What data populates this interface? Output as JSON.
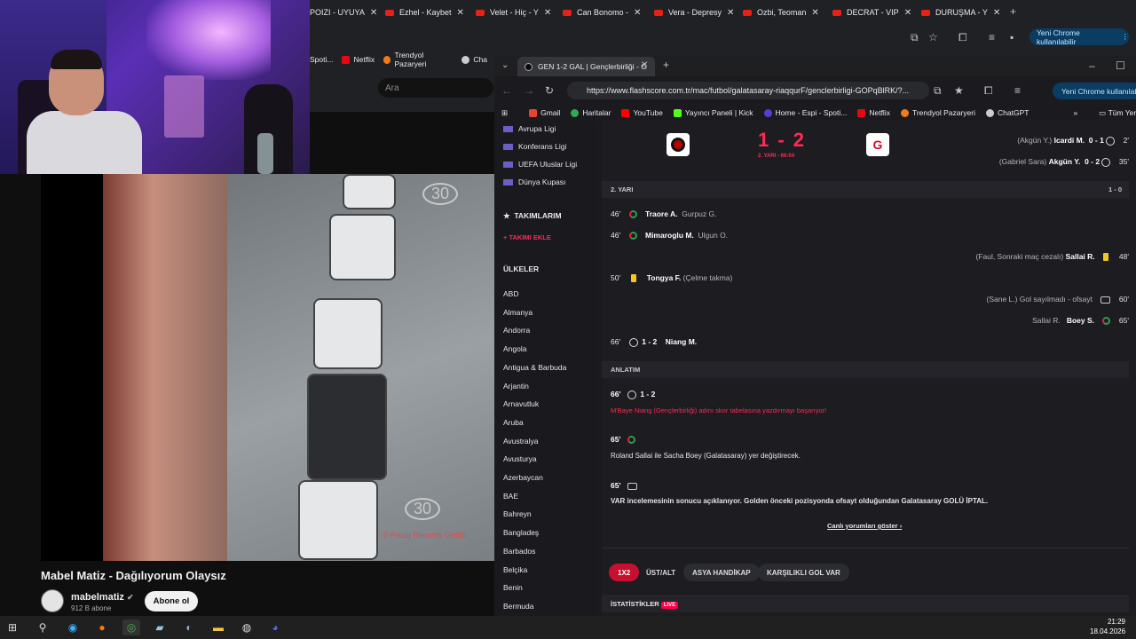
{
  "browser_top": {
    "tabs": [
      {
        "label": "POIZI - UYUYA"
      },
      {
        "label": "Ezhel - Kaybet"
      },
      {
        "label": "Velet - Hiç - Y"
      },
      {
        "label": "Can Bonomo -"
      },
      {
        "label": "Vera - Depresy"
      },
      {
        "label": "Ozbi, Teoman"
      },
      {
        "label": "DECRAT - VIP"
      },
      {
        "label": "DURUŞMA - Y"
      }
    ],
    "yeni_chrome": "Yeni Chrome kullanılabilir",
    "bookmarks": [
      "Spoti...",
      "Netflix",
      "Trendyol Pazaryeri",
      "Cha"
    ],
    "search_placeholder": "Ara"
  },
  "video": {
    "title": "Mabel Matiz - Dağılıyorum Olaysız",
    "channel": "mabelmatiz",
    "subscribers": "912 B abone",
    "subscribe_label": "Abone ol",
    "watermark": "© Pasaj Records Gmbh"
  },
  "browser2": {
    "tab_title": "GEN 1-2 GAL | Gençlerbirliği - G",
    "url": "https://www.flashscore.com.tr/mac/futbol/galatasaray-riaqqurF/genclerbirligi-GOPqBlRK/?...",
    "yeni_chrome": "Yeni Chrome kullanılabilir",
    "bookmarks": [
      "Gmail",
      "Haritalar",
      "YouTube",
      "Yayıncı Paneli | Kick",
      "Home - Espi - Spoti...",
      "Netflix",
      "Trendyol Pazaryeri",
      "ChatGPT"
    ],
    "all_bookmarks": "Tüm Yer İşa"
  },
  "sidebar": {
    "competitions": [
      "Avrupa Ligi",
      "Konferans Ligi",
      "UEFA Uluslar Ligi",
      "Dünya Kupası"
    ],
    "my_teams": "TAKIMLARIM",
    "add_team": "+ TAKIMI EKLE",
    "countries_title": "ÜLKELER",
    "countries": [
      "ABD",
      "Almanya",
      "Andorra",
      "Angola",
      "Antigua & Barbuda",
      "Arjantin",
      "Arnavutluk",
      "Aruba",
      "Avustralya",
      "Avusturya",
      "Azerbaycan",
      "BAE",
      "Bahreyn",
      "Bangladeş",
      "Barbados",
      "Belçika",
      "Benin",
      "Bermuda"
    ]
  },
  "match": {
    "score": "1 - 2",
    "status": "2. YARI - 66:04",
    "first_half_events": [
      {
        "assist": "(Akgün Y.)",
        "player": "Icardi M.",
        "score": "0 - 1",
        "minute": "2'"
      },
      {
        "assist": "(Gabriel Sara)",
        "player": "Akgün Y.",
        "score": "0 - 2",
        "minute": "35'"
      }
    ],
    "second_half_label": "2. YARI",
    "second_half_score": "1 - 0",
    "events": [
      {
        "minute": "46'",
        "player": "Traore A.",
        "detail": "Gurpuz G."
      },
      {
        "minute": "46'",
        "player": "Mimaroglu M.",
        "detail": "Ulgun O."
      },
      {
        "minute": "48'",
        "player": "Sallai R.",
        "detail": "(Faul, Sonraki maç cezalı)"
      },
      {
        "minute": "50'",
        "player": "Tongya F.",
        "detail": "(Çelme takma)"
      },
      {
        "minute": "60'",
        "player": "(Sane L.) Gol sayılmadı - ofsayt",
        "detail": ""
      },
      {
        "minute": "65'",
        "player": "Boey S.",
        "detail": "Sallai R."
      },
      {
        "minute": "66'",
        "player": "Niang M.",
        "detail": "1 - 2"
      }
    ],
    "commentary_label": "ANLATIM",
    "commentary": [
      {
        "minute": "66'",
        "score": "1 - 2",
        "text": "M'Baye Niang (Gençlerbirliği) adını skor tabelasına yazdırmayı başarıyor!"
      },
      {
        "minute": "65'",
        "score": "",
        "text": "Roland Sallai ile Sacha Boey (Galatasaray) yer değiştirecek."
      },
      {
        "minute": "65'",
        "score": "",
        "text": "VAR incelemesinin sonucu açıklanıyor. Golden önceki pozisyonda ofsayt olduğundan Galatasaray GOLÜ İPTAL."
      }
    ],
    "show_comments": "Canlı yorumları göster",
    "bet_tabs": [
      "1X2",
      "ÜST/ALT",
      "ASYA HANDİKAP",
      "KARŞILIKLI GOL VAR"
    ],
    "stats_label": "İSTATİSTİKLER",
    "live_badge": "LIVE"
  },
  "taskbar": {
    "time": "21:29",
    "date": "18.04.2026"
  },
  "colors": {
    "accent_red": "#ff2b52",
    "chrome_dark": "#202124",
    "flashscore_bg": "#1c1c21"
  }
}
